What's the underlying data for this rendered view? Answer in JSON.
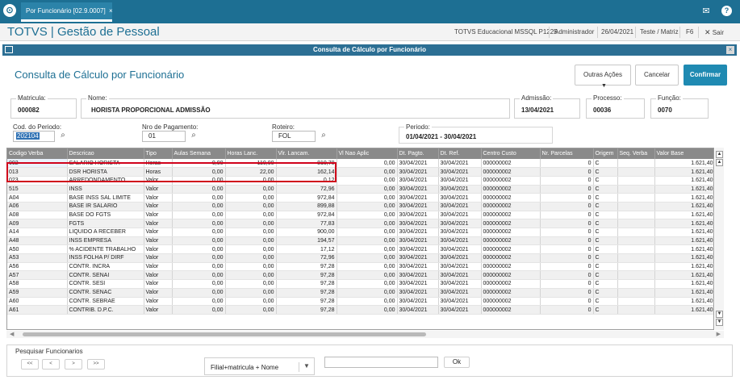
{
  "topbar": {
    "tab_label": "Por Funcionário [02.9.0007]",
    "tab_close": "×",
    "mail_icon": "envelope-icon",
    "help_icon": "question-icon"
  },
  "header": {
    "app_title": "TOTVS | Gestão de Pessoal",
    "company": "TOTVS Educacional MSSQL P1225",
    "user": "Administrador",
    "date": "26/04/2021",
    "branch": "Teste / Matriz",
    "shortcut": "F6",
    "exit_label": "Sair"
  },
  "window": {
    "title": "Consulta de Cálculo por Funcionário",
    "close": "×"
  },
  "page": {
    "title": "Consulta de Cálculo por Funcionário",
    "btn_outras": "Outras Ações",
    "btn_cancelar": "Cancelar",
    "btn_confirmar": "Confirmar"
  },
  "fields": {
    "matricula_label": "Matricula:",
    "matricula_value": "000082",
    "nome_label": "Nome:",
    "nome_value": "HORISTA PROPORCIONAL ADMISSÃO",
    "admissao_label": "Admissão:",
    "admissao_value": "13/04/2021",
    "processo_label": "Processo:",
    "processo_value": "00036",
    "funcao_label": "Função:",
    "funcao_value": "0070",
    "periodo_cod_label": "Cod. do Periodo:",
    "periodo_cod_value": "202104",
    "nro_pagto_label": "Nro de Pagamento:",
    "nro_pagto_value": "01",
    "roteiro_label": "Roteiro:",
    "roteiro_value": "FOL",
    "periodo_label": "Periodo:",
    "periodo_value": "01/04/2021 - 30/04/2021"
  },
  "grid": {
    "headers": [
      "Codigo Verba",
      "Descricao",
      "Tipo",
      "Aulas Semana",
      "Horas Lanc.",
      "Vlr. Lancam.",
      "Vl Nao Aplic",
      "Dt. Pagto.",
      "Dt. Ref.",
      "Centro Custo",
      "Nr. Parcelas",
      "Origem",
      "Seq. Verba",
      "Valor Base",
      ""
    ],
    "rows": [
      [
        "002",
        "SALARIO HORISTA",
        "Horas",
        "0,00",
        "110,00",
        "810,70",
        "0,00",
        "30/04/2021",
        "30/04/2021",
        "000000002",
        "0",
        "C",
        "",
        "1.621,40"
      ],
      [
        "013",
        "DSR HORISTA",
        "Horas",
        "0,00",
        "22,00",
        "162,14",
        "0,00",
        "30/04/2021",
        "30/04/2021",
        "000000002",
        "0",
        "C",
        "",
        "1.621,40"
      ],
      [
        "023",
        "ARREDONDAMENTO",
        "Valor",
        "0,00",
        "0,00",
        "0,12",
        "0,00",
        "30/04/2021",
        "30/04/2021",
        "000000002",
        "0",
        "C",
        "",
        "1.621,40"
      ],
      [
        "515",
        "INSS",
        "Valor",
        "0,00",
        "0,00",
        "72,96",
        "0,00",
        "30/04/2021",
        "30/04/2021",
        "000000002",
        "0",
        "C",
        "",
        "1.621,40"
      ],
      [
        "A04",
        "BASE INSS SAL LIMITE",
        "Valor",
        "0,00",
        "0,00",
        "972,84",
        "0,00",
        "30/04/2021",
        "30/04/2021",
        "000000002",
        "0",
        "C",
        "",
        "1.621,40"
      ],
      [
        "A06",
        "BASE IR SALARIO",
        "Valor",
        "0,00",
        "0,00",
        "899,88",
        "0,00",
        "30/04/2021",
        "30/04/2021",
        "000000002",
        "0",
        "C",
        "",
        "1.621,40"
      ],
      [
        "A08",
        "BASE DO FGTS",
        "Valor",
        "0,00",
        "0,00",
        "972,84",
        "0,00",
        "30/04/2021",
        "30/04/2021",
        "000000002",
        "0",
        "C",
        "",
        "1.621,40"
      ],
      [
        "A09",
        "FGTS",
        "Valor",
        "0,00",
        "0,00",
        "77,83",
        "0,00",
        "30/04/2021",
        "30/04/2021",
        "000000002",
        "0",
        "C",
        "",
        "1.621,40"
      ],
      [
        "A14",
        "LIQUIDO A RECEBER",
        "Valor",
        "0,00",
        "0,00",
        "900,00",
        "0,00",
        "30/04/2021",
        "30/04/2021",
        "000000002",
        "0",
        "C",
        "",
        "1.621,40"
      ],
      [
        "A48",
        "INSS EMPRESA",
        "Valor",
        "0,00",
        "0,00",
        "194,57",
        "0,00",
        "30/04/2021",
        "30/04/2021",
        "000000002",
        "0",
        "C",
        "",
        "1.621,40"
      ],
      [
        "A50",
        "% ACIDENTE TRABALHO",
        "Valor",
        "0,00",
        "0,00",
        "17,12",
        "0,00",
        "30/04/2021",
        "30/04/2021",
        "000000002",
        "0",
        "C",
        "",
        "1.621,40"
      ],
      [
        "A53",
        "INSS FOLHA P/ DIRF",
        "Valor",
        "0,00",
        "0,00",
        "72,96",
        "0,00",
        "30/04/2021",
        "30/04/2021",
        "000000002",
        "0",
        "C",
        "",
        "1.621,40"
      ],
      [
        "A56",
        "CONTR. INCRA",
        "Valor",
        "0,00",
        "0,00",
        "97,28",
        "0,00",
        "30/04/2021",
        "30/04/2021",
        "000000002",
        "0",
        "C",
        "",
        "1.621,40"
      ],
      [
        "A57",
        "CONTR. SENAI",
        "Valor",
        "0,00",
        "0,00",
        "97,28",
        "0,00",
        "30/04/2021",
        "30/04/2021",
        "000000002",
        "0",
        "C",
        "",
        "1.621,40"
      ],
      [
        "A58",
        "CONTR. SESI",
        "Valor",
        "0,00",
        "0,00",
        "97,28",
        "0,00",
        "30/04/2021",
        "30/04/2021",
        "000000002",
        "0",
        "C",
        "",
        "1.621,40"
      ],
      [
        "A59",
        "CONTR. SENAC",
        "Valor",
        "0,00",
        "0,00",
        "97,28",
        "0,00",
        "30/04/2021",
        "30/04/2021",
        "000000002",
        "0",
        "C",
        "",
        "1.621,40"
      ],
      [
        "A60",
        "CONTR. SEBRAE",
        "Valor",
        "0,00",
        "0,00",
        "97,28",
        "0,00",
        "30/04/2021",
        "30/04/2021",
        "000000002",
        "0",
        "C",
        "",
        "1.621,40"
      ],
      [
        "A61",
        "CONTRIB. D.P.C.",
        "Valor",
        "0,00",
        "0,00",
        "97,28",
        "0,00",
        "30/04/2021",
        "30/04/2021",
        "000000002",
        "0",
        "C",
        "",
        "1.621,40"
      ]
    ]
  },
  "pesquisa": {
    "label": "Pesquisar Funcionarios",
    "nav_first": "<<",
    "nav_prev": "<",
    "nav_next": ">",
    "nav_last": ">>",
    "order_value": "Filial+matricula + Nome",
    "search_value": "",
    "ok_label": "Ok"
  }
}
